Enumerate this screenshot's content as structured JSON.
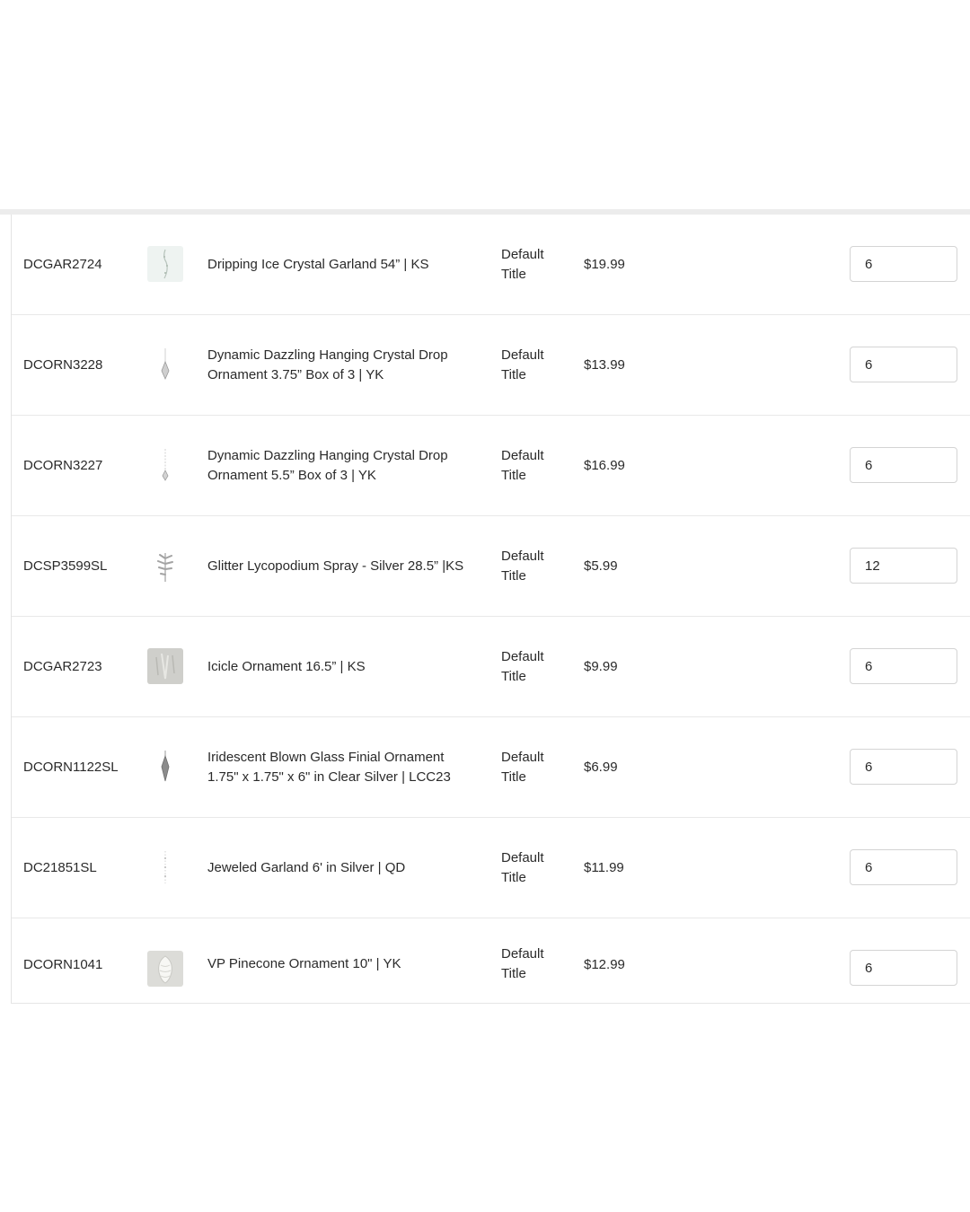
{
  "rows": [
    {
      "sku": "DCGAR2724",
      "title": "Dripping Ice Crystal Garland 54” | KS",
      "variant": "Default Title",
      "price": "$19.99",
      "qty": "6",
      "icon": "crystal-garland-thumbnail"
    },
    {
      "sku": "DCORN3228",
      "title": "Dynamic Dazzling Hanging Crystal Drop Ornament 3.75” Box of 3 | YK",
      "variant": "Default Title",
      "price": "$13.99",
      "qty": "6",
      "icon": "crystal-drop-thumbnail"
    },
    {
      "sku": "DCORN3227",
      "title": "Dynamic Dazzling Hanging Crystal Drop Ornament 5.5” Box of 3 | YK",
      "variant": "Default Title",
      "price": "$16.99",
      "qty": "6",
      "icon": "crystal-drop-thumbnail"
    },
    {
      "sku": "DCSP3599SL",
      "title": "Glitter Lycopodium Spray - Silver 28.5” |KS",
      "variant": "Default Title",
      "price": "$5.99",
      "qty": "12",
      "icon": "lycopodium-spray-thumbnail"
    },
    {
      "sku": "DCGAR2723",
      "title": "Icicle Ornament 16.5” | KS",
      "variant": "Default Title",
      "price": "$9.99",
      "qty": "6",
      "icon": "icicle-thumbnail"
    },
    {
      "sku": "DCORN1122SL",
      "title": "Iridescent Blown Glass Finial Ornament 1.75\" x 1.75\" x 6\" in Clear Silver | LCC23",
      "variant": "Default Title",
      "price": "$6.99",
      "qty": "6",
      "icon": "finial-ornament-thumbnail"
    },
    {
      "sku": "DC21851SL",
      "title": "Jeweled Garland 6' in Silver | QD",
      "variant": "Default Title",
      "price": "$11.99",
      "qty": "6",
      "icon": "jeweled-garland-thumbnail"
    },
    {
      "sku": "DCORN1041",
      "title": "VP Pinecone Ornament 10\" | YK",
      "variant": "Default Title",
      "price": "$12.99",
      "qty": "6",
      "icon": "pinecone-thumbnail"
    }
  ]
}
